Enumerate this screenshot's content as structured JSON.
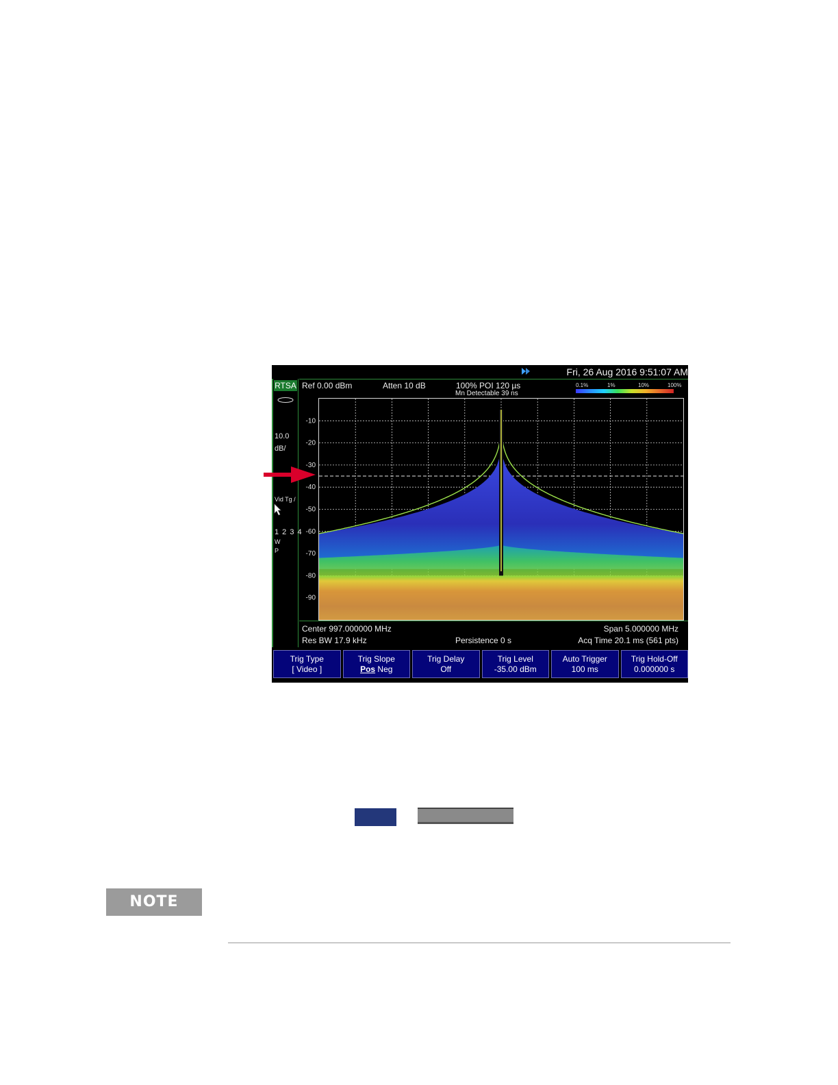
{
  "instrument": {
    "datetime": "Fri, 26 Aug 2016 9:51:07 AM",
    "mode": "RTSA",
    "header": {
      "ref": "Ref 0.00 dBm",
      "atten": "Atten 10 dB",
      "poi": "100% POI 120 µs",
      "min_detectable": "Mn Detectable 39 ns",
      "density_scale": [
        "0.1%",
        "1%",
        "10%",
        "100%"
      ]
    },
    "sidebar": {
      "scale_value": "10.0",
      "scale_unit": "dB/",
      "vid_trig": "Vid Tg /",
      "traces": "1 2 3 4",
      "trace_w": "W",
      "trace_p": "P"
    },
    "footer": {
      "center": "Center 997.000000 MHz",
      "span": "Span 5.000000 MHz",
      "res_bw": "Res BW 17.9 kHz",
      "persistence": "Persistence 0  s",
      "acq_time": "Acq Time 20.1 ms (561 pts)"
    },
    "softkeys": [
      {
        "line1": "Trig Type",
        "line2": "[ Video ]"
      },
      {
        "line1": "Trig Slope",
        "line2a": "Pos",
        "line2b": " Neg"
      },
      {
        "line1": "Trig Delay",
        "line2": "Off"
      },
      {
        "line1": "Trig Level",
        "line2": "-35.00 dBm"
      },
      {
        "line1": "Auto Trigger",
        "line2": "100 ms"
      },
      {
        "line1": "Trig Hold-Off",
        "line2": "0.000000 s"
      }
    ]
  },
  "chart_data": {
    "type": "heatmap",
    "title": "",
    "xlabel": "",
    "ylabel": "",
    "y_tick_labels": [
      "-10",
      "-20",
      "-30",
      "-40",
      "-50",
      "-60",
      "-70",
      "-80",
      "-90"
    ],
    "ylim": [
      -100,
      0
    ],
    "xlim_mhz": [
      994.5,
      999.5
    ],
    "center_mhz": 997.0,
    "span_mhz": 5.0,
    "peak_dbm": -5,
    "trigger_level_dbm": -35,
    "noise_floor_dbm": [
      -80,
      -100
    ],
    "grid": true
  },
  "annotations": {
    "arrow_color": "#d9002b"
  },
  "page": {
    "note_label": "NOTE"
  }
}
